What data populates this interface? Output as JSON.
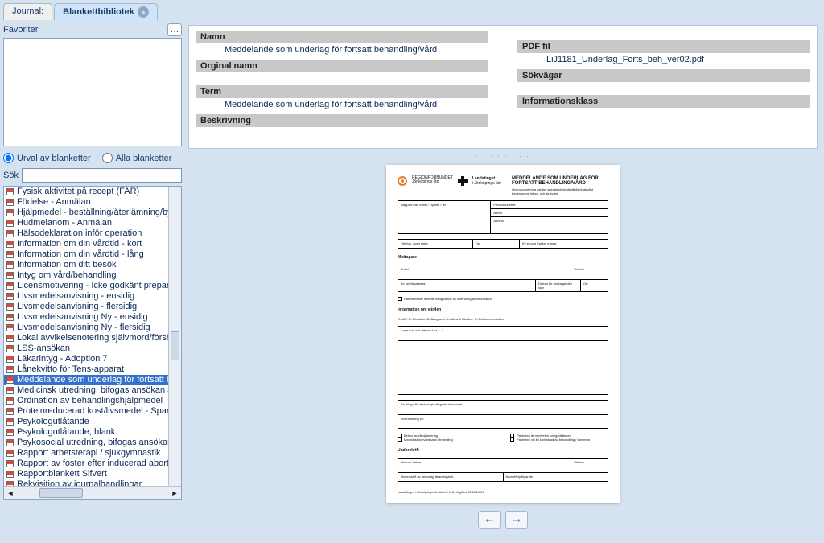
{
  "tabs": {
    "journal": "Journal:",
    "library": "Blankettbibliotek"
  },
  "left": {
    "favorites_label": "Favoriter",
    "radio_urval": "Urval av blanketter",
    "radio_alla": "Alla blanketter",
    "sok_label": "Sök",
    "items": [
      "Fysisk aktivitet på recept (FAR)",
      "Födelse - Anmälan",
      "Hjälpmedel - beställning/återlämning/byt",
      "Hudmelanom - Anmälan",
      "Hälsodeklaration inför operation",
      "Information om din vårdtid - kort",
      "Information om din vårdtid - lång",
      "Information om ditt besök",
      "Intyg om vård/behandling",
      "Licensmotivering - Icke godkänt preparat",
      "Livsmedelsanvisning - ensidig",
      "Livsmedelsanvisning - flersidig",
      "Livsmedelsanvisning Ny - ensidig",
      "Livsmedelsanvisning Ny - flersidig",
      "Lokal avvikelsenotering självmord/försök",
      "LSS-ansökan",
      "Läkarintyg - Adoption 7",
      "Lånekvitto för Tens-apparat",
      "Meddelande som underlag för fortsatt be",
      "Medicinsk utredning, bifogas ansökan at",
      "Ordination av behandlingshjälpmedel",
      "Proteinreducerad kost/livsmedel - Spann",
      "Psykologutlåtande",
      "Psykologutlåtande, blank",
      "Psykosocial utredning, bifogas ansökan",
      "Rapport arbetsterapi / sjukgymnastik",
      "Rapport av foster efter inducerad abort på",
      "Rapportblankett Sifvert",
      "Rekvisition av journalhandlingar"
    ],
    "selected_index": 18
  },
  "detail": {
    "namn_label": "Namn",
    "namn_value": "Meddelande som underlag för fortsatt behandling/vård",
    "orginal_label": "Orginal namn",
    "term_label": "Term",
    "term_value": "Meddelande som underlag för fortsatt behandling/vård",
    "beskrivning_label": "Beskrivning",
    "pdf_label": "PDF fil",
    "pdf_value": "LiJ1181_Underlag_Forts_beh_ver02.pdf",
    "sokvagar_label": "Sökvägar",
    "infoklass_label": "Informationsklass"
  },
  "preview": {
    "brand1a": "REGIONFÖRBUNDET",
    "brand1b": "Jönköpings län",
    "brand2a": "Landstinget",
    "brand2b": "i Jönköpings län",
    "title1": "MEDDELANDE SOM UNDERLAG FÖR",
    "title2": "FORTSATT BEHANDLING/VÅRD",
    "subtitle": "Överrapportering mellan specialist/primärvård/primärvård kommunens hälso- och sjukvård",
    "f_from": "Rapport från enhet / ifyllare / tel",
    "f_person": "Personnummer",
    "f_namn": "Namn",
    "f_adress": "Adress",
    "f_tel": "Telefon, även riktnr",
    "f_fax": "Fax",
    "f_ehalsa": "Ev e-post / säker e-post",
    "sec_mott": "Mottagare",
    "m_enhet": "Enhet",
    "m_tel": "Telefon",
    "m_bes": "Ev besöksadress",
    "m_date": "Datum för mottagande / sign",
    "m_ort": "Ort",
    "chk_consent": "Patienten har lämnat medgivande till överföring av information",
    "sec_info": "Information om vården",
    "info_sub": "S=Mål, B=Situation, B=Bakgrund, A=Aktuellt tillstånd, R=Rekommendation",
    "box_top": "Ange kod och datum, t ex 1, 2",
    "box_mid": "Se bilaga för text; ange bifogade dokument",
    "box_ov": "Överlämning till:",
    "chk_b1": "Behov av vårdplanering",
    "chk_b2": "Medicinsk/omvårdnads förmedling",
    "chk_b3": "Patienten är medveten om/godkänner",
    "chk_b4": "Patienten vill bli kontaktad av behandling / kommun",
    "sec_sign": "Underskrift",
    "s_ort": "Ort och datum",
    "s_tel": "Telefon",
    "s_name": "Underskrift av ansvarig läkare/sjuksk.",
    "s_clar": "Namnförtydligande",
    "footer": "Landstinget i Jönköpings län för LiJ 1181 Utgåva 02 2013-01"
  }
}
